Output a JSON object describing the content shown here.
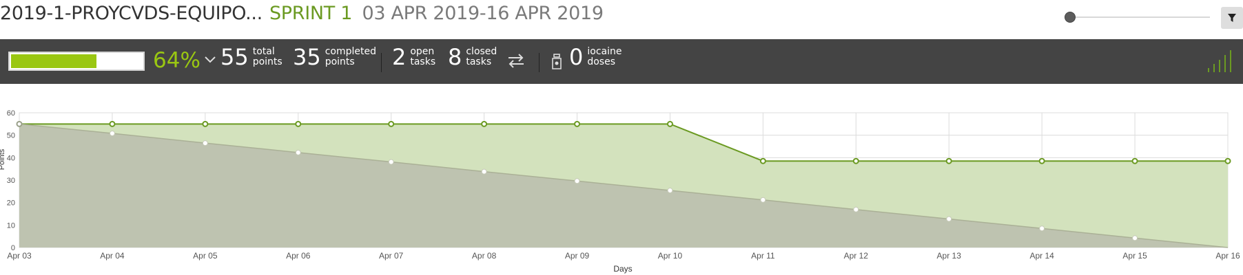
{
  "header": {
    "project": "2019-1-PROYCVDS-EQUIPO...",
    "sprint": "SPRINT 1",
    "dates": "03 APR 2019-16 APR 2019",
    "zoom_level": 0
  },
  "summary": {
    "progress_percent": 64,
    "progress_fill": 0.64,
    "percent_label": "64%",
    "total_points": "55",
    "total_label_1": "total",
    "total_label_2": "points",
    "completed_points": "35",
    "completed_label_1": "completed",
    "completed_label_2": "points",
    "open_tasks": "2",
    "open_label_1": "open",
    "open_label_2": "tasks",
    "closed_tasks": "8",
    "closed_label_1": "closed",
    "closed_label_2": "tasks",
    "iocaine": "0",
    "iocaine_label_1": "iocaine",
    "iocaine_label_2": "doses"
  },
  "colors": {
    "accent_green": "#9ac712",
    "line_green": "#6b9a22",
    "area_green": "#d3e2bd",
    "area_grey": "#bec3b0",
    "bar_bg": "#444444"
  },
  "chart_data": {
    "type": "area",
    "xlabel": "Days",
    "ylabel": "Points",
    "ylim": [
      0,
      60
    ],
    "yticks": [
      "0",
      "10",
      "20",
      "30",
      "40",
      "50",
      "60"
    ],
    "categories": [
      "Apr 03",
      "Apr 04",
      "Apr 05",
      "Apr 06",
      "Apr 07",
      "Apr 08",
      "Apr 09",
      "Apr 10",
      "Apr 11",
      "Apr 12",
      "Apr 13",
      "Apr 14",
      "Apr 15",
      "Apr 16"
    ],
    "grid": true,
    "series": [
      {
        "name": "",
        "values": [
          55,
          55,
          55,
          55,
          55,
          55,
          55,
          55,
          38.5,
          38.5,
          38.5,
          38.5,
          38.5,
          38.5
        ]
      },
      {
        "name": "",
        "values": [
          55,
          50.8,
          46.5,
          42.3,
          38.1,
          33.8,
          29.6,
          25.4,
          21.2,
          16.9,
          12.7,
          8.5,
          4.2,
          0
        ]
      }
    ]
  }
}
